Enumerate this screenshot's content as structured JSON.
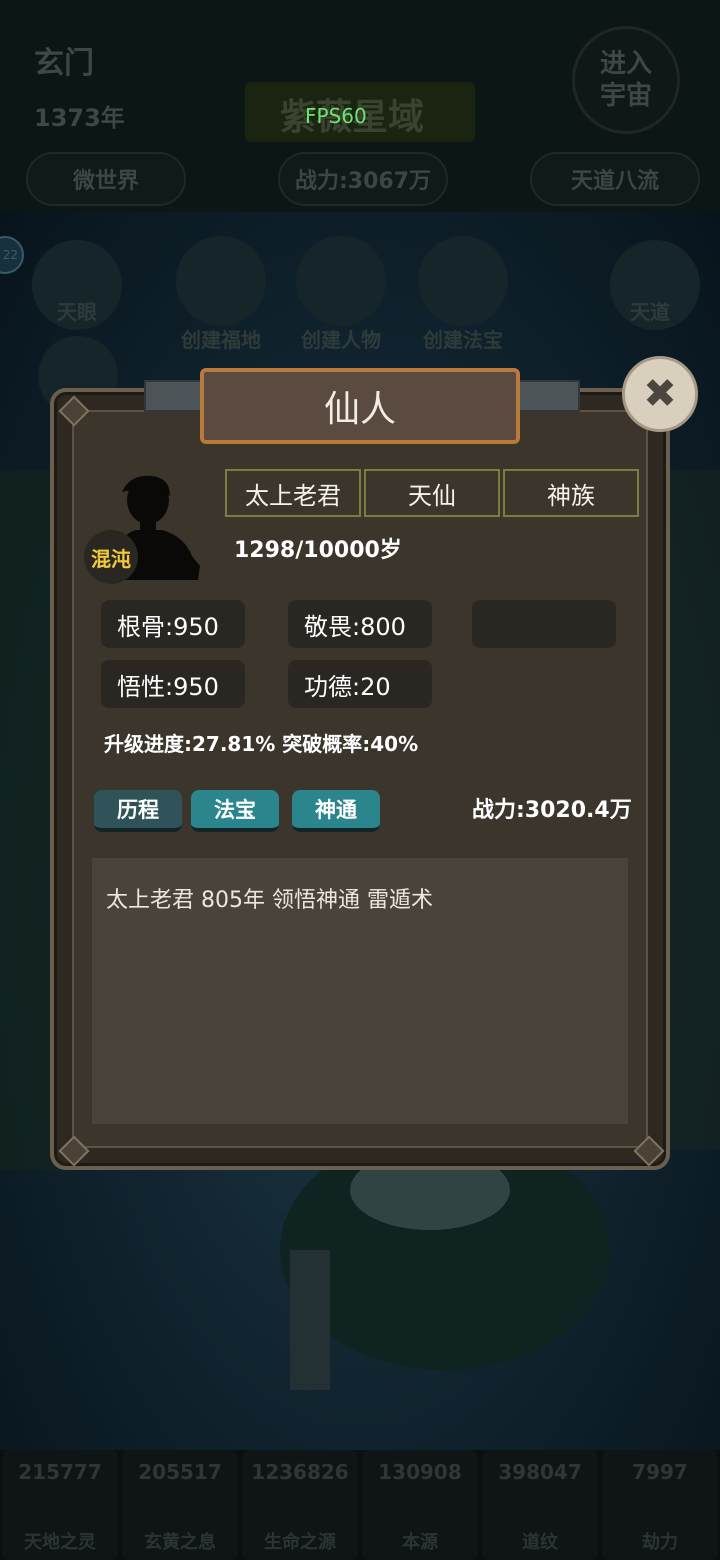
{
  "header": {
    "sect_name": "玄门",
    "year": "1373年",
    "region_title": "紫薇星域",
    "fps": "FPS60",
    "enter_universe": "进入宇宙",
    "micro_world": "微世界",
    "total_power": "战力:3067万",
    "rank": "天道八流"
  },
  "side_badge": "22",
  "actions": [
    {
      "label": "天眼",
      "icon": "eye-icon"
    },
    {
      "label": "创建福地",
      "icon": "mountain-icon"
    },
    {
      "label": "创建人物",
      "icon": "add-person-icon"
    },
    {
      "label": "创建法宝",
      "icon": "lotus-icon"
    },
    {
      "label": "天道",
      "icon": "swirl-icon"
    }
  ],
  "resources": [
    {
      "value": "215777",
      "label": "天地之灵"
    },
    {
      "value": "205517",
      "label": "玄黄之息"
    },
    {
      "value": "1236826",
      "label": "生命之源"
    },
    {
      "value": "130908",
      "label": "本源"
    },
    {
      "value": "398047",
      "label": "道纹"
    },
    {
      "value": "7997",
      "label": "劫力"
    }
  ],
  "dialog": {
    "title": "仙人",
    "badge": "混沌",
    "name": "太上老君",
    "realm": "天仙",
    "race": "神族",
    "age": "1298/10000岁",
    "stats": {
      "bone": "根骨:950",
      "awe": "敬畏:800",
      "insight": "悟性:950",
      "merit": "功德:20"
    },
    "progress": "升级进度:27.81% 突破概率:40%",
    "tabs": [
      "历程",
      "法宝",
      "神通"
    ],
    "active_tab": "历程",
    "power": "战力:3020.4万",
    "log": "太上老君 805年 领悟神通 雷遁术"
  },
  "colors": {
    "accent_teal": "#2b858d",
    "badge_gold": "#f2c93a",
    "fps_green": "#6ee36e",
    "frame_brown": "#b97b3a"
  }
}
